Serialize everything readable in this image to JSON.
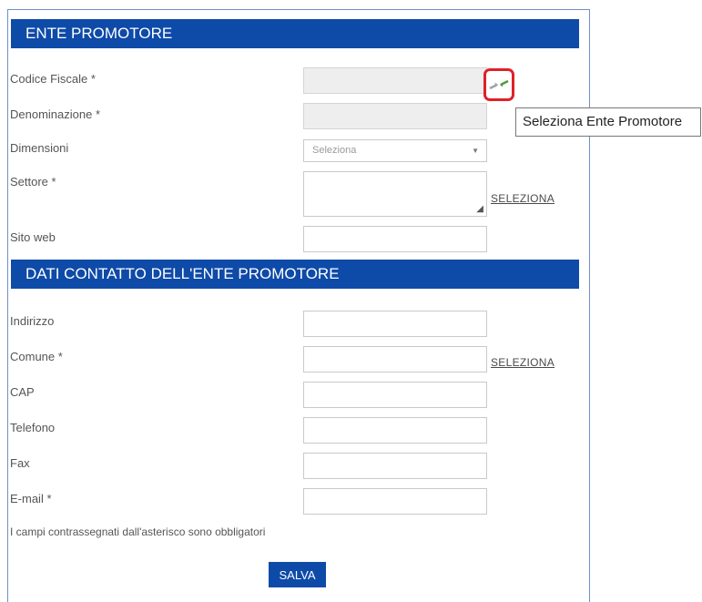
{
  "sections": {
    "ente": "ENTE PROMOTORE",
    "contatti": "DATI CONTATTO DELL'ENTE PROMOTORE"
  },
  "fields": {
    "codice_fiscale": {
      "label": "Codice Fiscale *",
      "value": ""
    },
    "denominazione": {
      "label": "Denominazione *",
      "value": ""
    },
    "dimensioni": {
      "label": "Dimensioni",
      "selected": "Seleziona"
    },
    "settore": {
      "label": "Settore *",
      "value": ""
    },
    "sito_web": {
      "label": "Sito web",
      "value": ""
    },
    "indirizzo": {
      "label": "Indirizzo",
      "value": ""
    },
    "comune": {
      "label": "Comune *",
      "value": ""
    },
    "cap": {
      "label": "CAP",
      "value": ""
    },
    "telefono": {
      "label": "Telefono",
      "value": ""
    },
    "fax": {
      "label": "Fax",
      "value": ""
    },
    "email": {
      "label": "E-mail *",
      "value": ""
    }
  },
  "links": {
    "seleziona_settore": "SELEZIONA",
    "seleziona_comune": "SELEZIONA"
  },
  "tooltip": "Seleziona Ente Promotore",
  "icons": {
    "select_ente": "arrows-in-icon"
  },
  "note": "I campi contrassegnati dall'asterisco sono obbligatori",
  "buttons": {
    "save": "SALVA"
  },
  "colors": {
    "header_bg": "#0e4aa8",
    "highlight": "#e0202a"
  }
}
